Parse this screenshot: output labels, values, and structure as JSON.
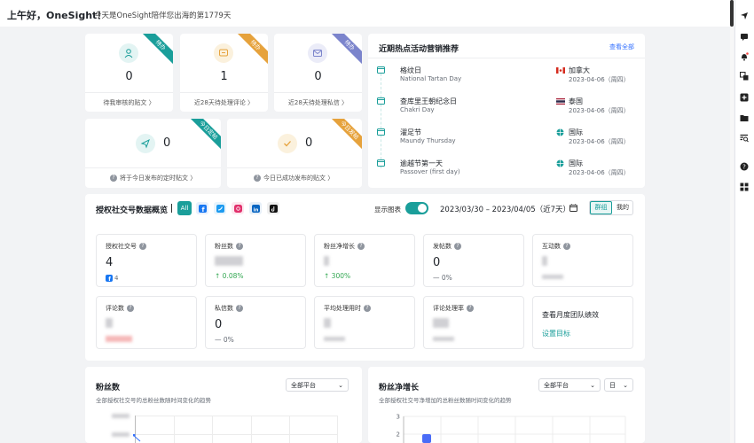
{
  "header": {
    "greeting": "上午好，OneSight！",
    "subtitle": "今天是OneSight陪伴您出海的第1779天"
  },
  "stats_top": [
    {
      "value": "0",
      "label": "待我审核的贴文 〉",
      "badge": "待办",
      "color": "#1a9e9a"
    },
    {
      "value": "1",
      "label": "近28天待处理评论 〉",
      "badge": "待办",
      "color": "#e6a23c"
    },
    {
      "value": "0",
      "label": "近28天待处理私信 〉",
      "badge": "待办",
      "color": "#7b84cc"
    }
  ],
  "stats_bottom": [
    {
      "value": "0",
      "label": "将于今日发布的定时贴文 〉",
      "badge": "今日定帖",
      "color": "#1a9e9a"
    },
    {
      "value": "0",
      "label": "今日已成功发布的贴文 〉",
      "badge": "今日发帖",
      "color": "#e6a23c"
    }
  ],
  "events": {
    "title": "近期热点活动营销推荐",
    "view_all": "查看全部",
    "items": [
      {
        "name": "格纹日",
        "en": "National Tartan Day",
        "region": "加拿大",
        "date": "2023-04-06（周四）",
        "flag": "canada"
      },
      {
        "name": "查库里王朝纪念日",
        "en": "Chakri Day",
        "region": "泰国",
        "date": "2023-04-06（周四）",
        "flag": "thailand"
      },
      {
        "name": "濯足节",
        "en": "Maundy Thursday",
        "region": "国际",
        "date": "2023-04-06（周四）",
        "flag": "globe"
      },
      {
        "name": "逾越节第一天",
        "en": "Passover (first day)",
        "region": "国际",
        "date": "2023-04-06（周四）",
        "flag": "globe"
      }
    ]
  },
  "overview": {
    "title": "授权社交号数据概览",
    "platforms": [
      "All",
      "facebook",
      "twitter",
      "instagram",
      "linkedin",
      "tiktok"
    ],
    "show_chart_label": "显示图表",
    "date_range": "2023/03/30 – 2023/04/05（近7天）",
    "group_tabs": [
      "群组",
      "我的"
    ],
    "metrics": [
      {
        "label": "授权社交号",
        "value": "4",
        "sub": "4"
      },
      {
        "label": "粉丝数",
        "value": "",
        "sub": "0.08%"
      },
      {
        "label": "粉丝净增长",
        "value": "",
        "sub": "300%"
      },
      {
        "label": "发帖数",
        "value": "0",
        "sub": "— 0%"
      },
      {
        "label": "互动数",
        "value": "",
        "sub": ""
      },
      {
        "label": "评论数",
        "value": "",
        "sub": ""
      },
      {
        "label": "私信数",
        "value": "0",
        "sub": "— 0%"
      },
      {
        "label": "平均处理用时",
        "value": "",
        "sub": ""
      },
      {
        "label": "评论处理率",
        "value": "",
        "sub": ""
      }
    ],
    "team_card": {
      "title": "查看月度团队绩效",
      "link": "设置目标"
    }
  },
  "fans_panel": {
    "title": "粉丝数",
    "desc": "全部授权社交号的总粉丝数随时间变化的趋势",
    "platform": "全部平台"
  },
  "growth_panel": {
    "title": "粉丝净增长",
    "desc": "全部授权社交号净增加的总粉丝数随时间变化的趋势",
    "platform": "全部平台",
    "granularity": "日"
  },
  "chart_data": {
    "type": "bar",
    "title": "粉丝净增长",
    "y_ticks": [
      "3",
      "2"
    ],
    "values": [
      2
    ],
    "ylim": [
      0,
      3
    ]
  }
}
